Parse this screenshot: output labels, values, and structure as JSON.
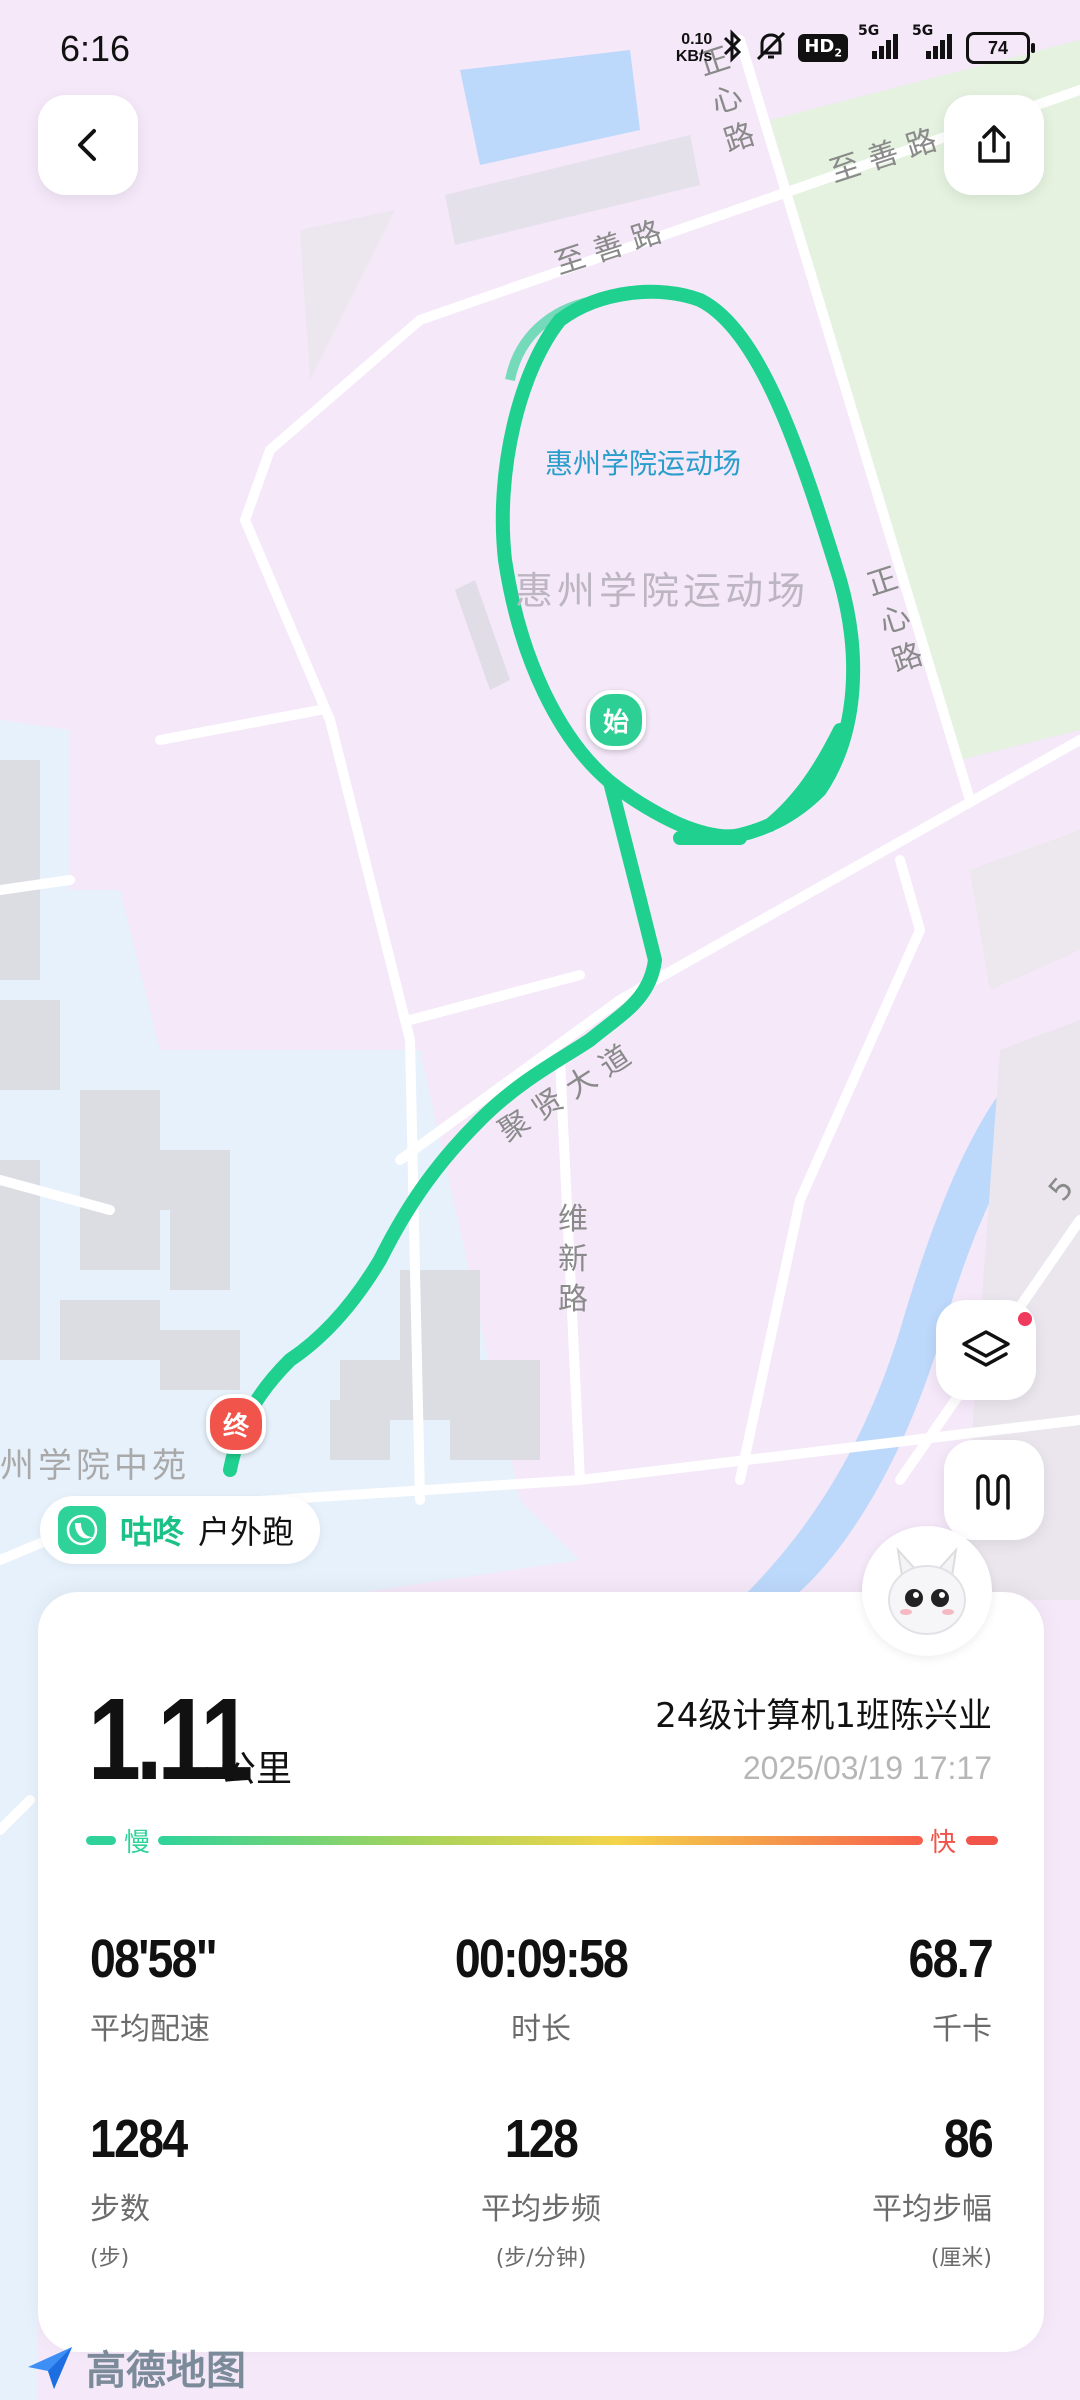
{
  "status_bar": {
    "time": "6:16",
    "net_speed_value": "0.10",
    "net_speed_unit": "KB/s",
    "hd": "HD",
    "hd_sub": "2",
    "sig1": "5G",
    "sig2": "5G",
    "battery": "74"
  },
  "map": {
    "labels": {
      "road_zhishan_1": "至善路",
      "road_zhishan_2": "至善路",
      "road_zhengxin_1": "正心路",
      "road_zhengxin_2": "正心路",
      "stadium_marker": "惠州学院运动场",
      "stadium_area": "惠州学院运动场",
      "road_juxian": "聚贤大道",
      "road_weixin": "维新路",
      "zhongyuan": "州学院中苑",
      "road_5": "5"
    },
    "start_pin": "始",
    "end_pin": "终",
    "colors": {
      "route": "#1fd08f",
      "start": "#2ecf95",
      "end": "#f0544a"
    }
  },
  "app_badge": {
    "brand": "咕咚",
    "activity": "户外跑"
  },
  "summary": {
    "distance": "1.11",
    "distance_unit": "公里",
    "user": "24级计算机1班陈兴业",
    "datetime": "2025/03/19 17:17",
    "speed_slow": "慢",
    "speed_fast": "快",
    "stats": [
      {
        "value": "08'58\"",
        "label": "平均配速",
        "unit": ""
      },
      {
        "value": "00:09:58",
        "label": "时长",
        "unit": ""
      },
      {
        "value": "68.7",
        "label": "千卡",
        "unit": ""
      },
      {
        "value": "1284",
        "label": "步数",
        "unit": "(步)"
      },
      {
        "value": "128",
        "label": "平均步频",
        "unit": "(步/分钟)"
      },
      {
        "value": "86",
        "label": "平均步幅",
        "unit": "(厘米)"
      }
    ]
  },
  "watermark": "高德地图"
}
